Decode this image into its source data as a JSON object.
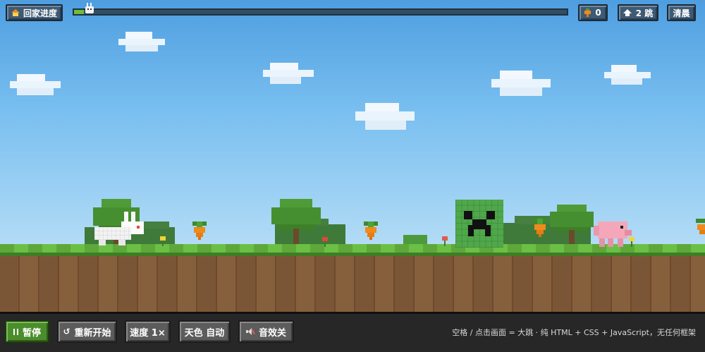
{
  "hud": {
    "home_label": "回家进度",
    "progress": 0.02,
    "carrots": "0",
    "jumps": "2 跳",
    "time_of_day": "清晨"
  },
  "toolbar": {
    "pause_label": "暂停",
    "restart_label": "重新开始",
    "speed_label": "速度 1×",
    "sky_label": "天色 自动",
    "sound_label": "音效关",
    "hint": "空格 / 点击画面 = 大跳 · 纯 HTML + CSS + JavaScript，无任何框架"
  },
  "colors": {
    "grass": "#5ea83a",
    "dirt": "#7b5636",
    "sky_top": "#4e9ee0",
    "creeper": "#4fa84a",
    "carrot": "#f08a1a"
  },
  "icons": {
    "home": "house-icon",
    "carrot": "carrot-icon",
    "jump": "jump-arrow-icon",
    "pause": "pause-icon",
    "restart": "restart-icon",
    "sound": "muted-speaker-icon"
  }
}
